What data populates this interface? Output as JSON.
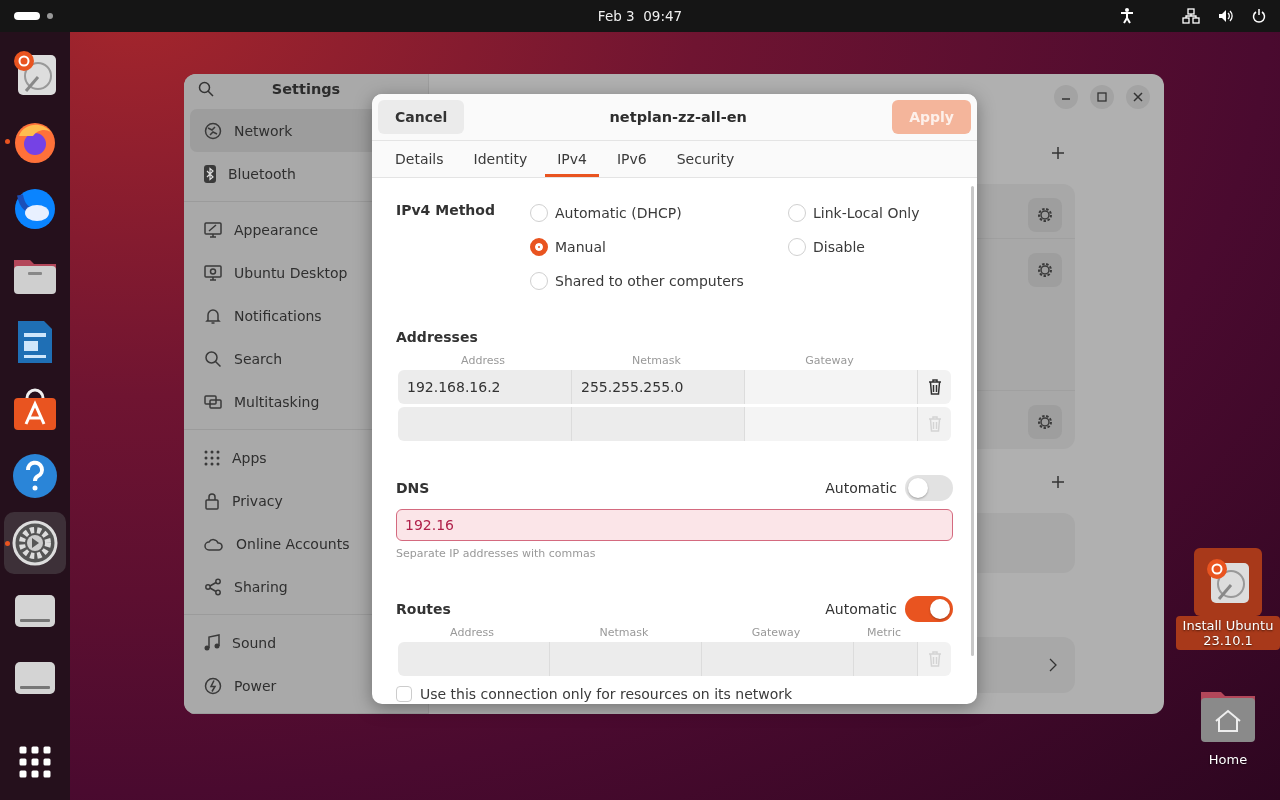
{
  "top_bar": {
    "clock": "Feb 3  09:47"
  },
  "dock": {
    "items": [
      {
        "kind": "installer",
        "running": false,
        "selected": false
      },
      {
        "kind": "browser",
        "running": true,
        "selected": false
      },
      {
        "kind": "mail",
        "running": false,
        "selected": false
      },
      {
        "kind": "folder",
        "running": false,
        "selected": false
      },
      {
        "kind": "document",
        "running": false,
        "selected": false
      },
      {
        "kind": "store",
        "running": false,
        "selected": false
      },
      {
        "kind": "help",
        "running": false,
        "selected": false
      },
      {
        "kind": "settings",
        "running": true,
        "selected": true
      },
      {
        "kind": "drive",
        "running": false,
        "selected": false
      },
      {
        "kind": "drive",
        "running": false,
        "selected": false
      }
    ]
  },
  "settings": {
    "title": "Settings",
    "sidebar": [
      [
        {
          "label": "Network",
          "kind": "network",
          "selected": true
        },
        {
          "label": "Bluetooth",
          "kind": "bluetooth",
          "selected": false
        }
      ],
      [
        {
          "label": "Appearance",
          "kind": "appearance",
          "selected": false
        },
        {
          "label": "Ubuntu Desktop",
          "kind": "desktop",
          "selected": false
        },
        {
          "label": "Notifications",
          "kind": "bell",
          "selected": false
        },
        {
          "label": "Search",
          "kind": "search",
          "selected": false
        },
        {
          "label": "Multitasking",
          "kind": "multitask",
          "selected": false
        }
      ],
      [
        {
          "label": "Apps",
          "kind": "apps",
          "selected": false
        },
        {
          "label": "Privacy",
          "kind": "lock",
          "selected": false
        },
        {
          "label": "Online Accounts",
          "kind": "cloud",
          "selected": false
        },
        {
          "label": "Sharing",
          "kind": "share",
          "selected": false
        }
      ],
      [
        {
          "label": "Sound",
          "kind": "note",
          "selected": false
        },
        {
          "label": "Power",
          "kind": "power",
          "selected": false
        }
      ]
    ],
    "sections": [
      {
        "addable": true,
        "rows": [
          {
            "kind": "gear"
          },
          {
            "kind": "gear-tall"
          },
          {
            "kind": "gear"
          }
        ]
      },
      {
        "addable": true,
        "rows": [
          {
            "kind": "empty"
          }
        ]
      },
      {
        "addable": false,
        "rows": [
          {
            "kind": "chevron"
          }
        ]
      }
    ]
  },
  "dialog": {
    "cancel": "Cancel",
    "title": "netplan-zz-all-en",
    "apply": "Apply",
    "apply_disabled": true,
    "tabs": [
      {
        "label": "Details",
        "selected": false
      },
      {
        "label": "Identity",
        "selected": false
      },
      {
        "label": "IPv4",
        "selected": true
      },
      {
        "label": "IPv6",
        "selected": false
      },
      {
        "label": "Security",
        "selected": false
      }
    ],
    "method_label": "IPv4 Method",
    "methods": [
      {
        "label": "Automatic (DHCP)",
        "selected": false
      },
      {
        "label": "Link-Local Only",
        "selected": false
      },
      {
        "label": "Manual",
        "selected": true
      },
      {
        "label": "Disable",
        "selected": false
      },
      {
        "label": "Shared to other computers",
        "selected": false
      }
    ],
    "addresses": {
      "title": "Addresses",
      "columns": [
        "Address",
        "Netmask",
        "Gateway"
      ],
      "rows": [
        {
          "address": "192.168.16.2",
          "netmask": "255.255.255.0",
          "deletable": true
        },
        {
          "deletable": false
        }
      ]
    },
    "dns": {
      "title": "DNS",
      "auto_label": "Automatic",
      "automatic": false,
      "value": "192.16",
      "invalid": true,
      "hint": "Separate IP addresses with commas"
    },
    "routes": {
      "title": "Routes",
      "auto_label": "Automatic",
      "automatic": true,
      "columns": [
        "Address",
        "Netmask",
        "Gateway",
        "Metric"
      ],
      "rows": [
        {
          "deletable": false
        }
      ]
    },
    "only_local": {
      "label": "Use this connection only for resources on its network",
      "checked": false
    }
  },
  "desktop_icons": [
    {
      "label": "Install Ubuntu 23.10.1",
      "kind": "installer",
      "selected": true
    },
    {
      "label": "Home",
      "kind": "home",
      "selected": false
    }
  ]
}
